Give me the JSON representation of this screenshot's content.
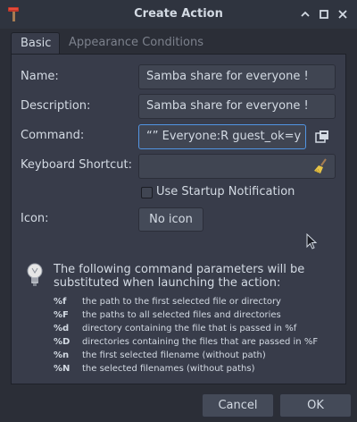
{
  "window": {
    "title": "Create Action"
  },
  "tabs": [
    {
      "label": "Basic",
      "active": true
    },
    {
      "label": "Appearance Conditions",
      "active": false
    }
  ],
  "form": {
    "name_label": "Name:",
    "name_value": "Samba share for everyone !",
    "description_label": "Description:",
    "description_value": "Samba share for everyone !",
    "command_label": "Command:",
    "command_value": "“” Everyone:R guest_ok=y",
    "shortcut_label": "Keyboard Shortcut:",
    "shortcut_value": "",
    "startup_notification_label": "Use Startup Notification",
    "startup_notification_checked": false,
    "icon_label": "Icon:",
    "icon_button_label": "No icon"
  },
  "info": {
    "text": "The following command parameters will be substituted when launching the action:",
    "params": [
      {
        "code": "%f",
        "desc": "the path to the first selected file or directory"
      },
      {
        "code": "%F",
        "desc": "the paths to all selected files and directories"
      },
      {
        "code": "%d",
        "desc": "directory containing the file that is passed in %f"
      },
      {
        "code": "%D",
        "desc": "directories containing the files that are passed in %F"
      },
      {
        "code": "%n",
        "desc": "the first selected filename (without path)"
      },
      {
        "code": "%N",
        "desc": "the selected filenames (without paths)"
      }
    ]
  },
  "buttons": {
    "cancel": "Cancel",
    "ok": "OK"
  },
  "icons": {
    "app": "hammer-icon",
    "minimize": "chevron-up-icon",
    "maximize": "square-icon",
    "close": "close-icon",
    "browse": "browse-icon",
    "clear": "broom-icon",
    "info": "lightbulb-icon"
  },
  "colors": {
    "window_bg": "#2b2e37",
    "panel_bg": "#383c4a",
    "accent": "#5294e2",
    "text": "#d3dae3"
  }
}
